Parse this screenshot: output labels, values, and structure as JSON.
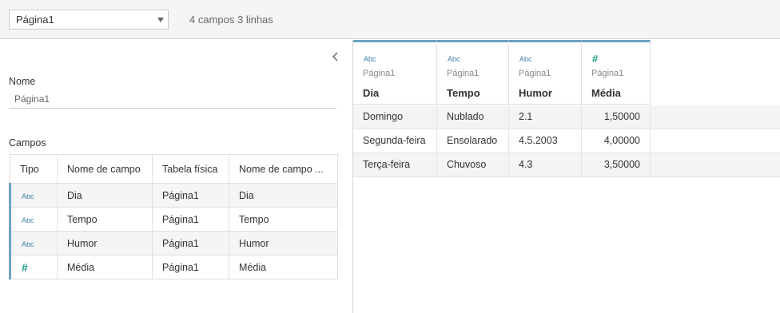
{
  "header": {
    "source_select": "Página1",
    "summary": "4 campos 3 linhas"
  },
  "details": {
    "name_label": "Nome",
    "name_value": "Página1",
    "fields_label": "Campos",
    "columns": [
      "Tipo",
      "Nome de campo",
      "Tabela física",
      "Nome de campo ..."
    ],
    "rows": [
      {
        "type": "Abc",
        "name": "Dia",
        "table": "Página1",
        "remote": "Dia"
      },
      {
        "type": "Abc",
        "name": "Tempo",
        "table": "Página1",
        "remote": "Tempo"
      },
      {
        "type": "Abc",
        "name": "Humor",
        "table": "Página1",
        "remote": "Humor"
      },
      {
        "type": "#",
        "name": "Média",
        "table": "Página1",
        "remote": "Média"
      }
    ]
  },
  "grid": {
    "columns": [
      {
        "type": "Abc",
        "source": "Página1",
        "name": "Dia"
      },
      {
        "type": "Abc",
        "source": "Página1",
        "name": "Tempo"
      },
      {
        "type": "Abc",
        "source": "Página1",
        "name": "Humor"
      },
      {
        "type": "#",
        "source": "Página1",
        "name": "Média"
      }
    ],
    "rows": [
      [
        "Domingo",
        "Nublado",
        "2.1",
        "1,50000"
      ],
      [
        "Segunda-feira",
        "Ensolarado",
        "4.5.2003",
        "4,00000"
      ],
      [
        "Terça-feira",
        "Chuvoso",
        "4.3",
        "3,50000"
      ]
    ]
  },
  "colors": {
    "accent": "#6ba2c0",
    "abc": "#3a7fa8",
    "number": "#1fa085"
  }
}
